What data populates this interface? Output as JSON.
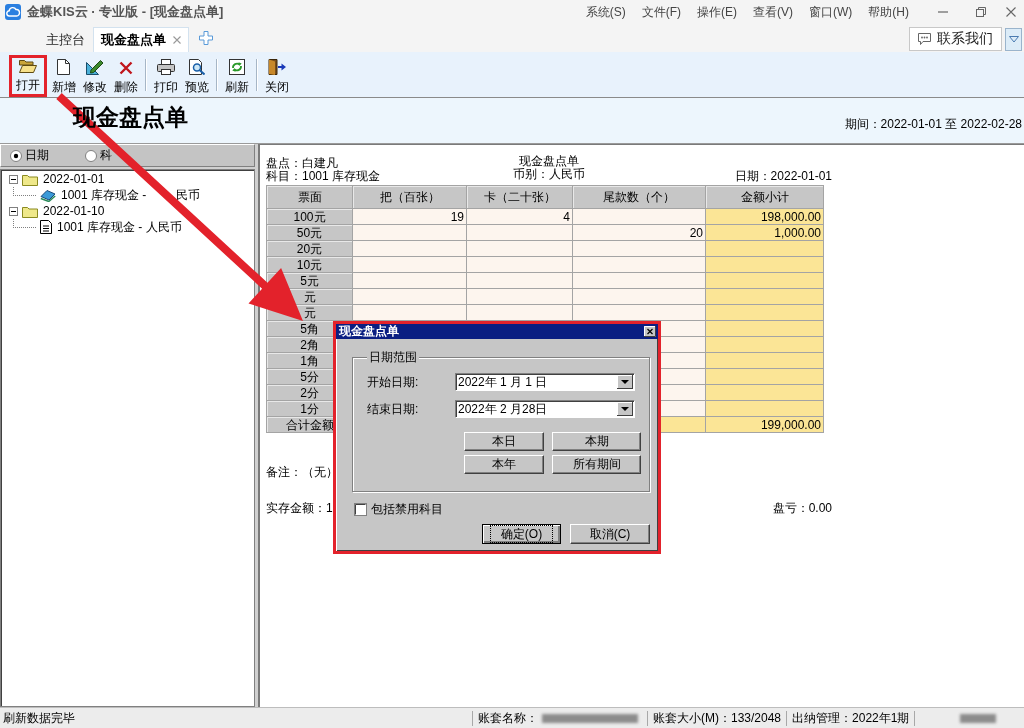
{
  "window": {
    "title": "金蝶KIS云 · 专业版 - [现金盘点单]",
    "menu": [
      "系统(S)",
      "文件(F)",
      "操作(E)",
      "查看(V)",
      "窗口(W)",
      "帮助(H)"
    ]
  },
  "tabs": [
    {
      "label": "主控台",
      "selected": false,
      "closable": false
    },
    {
      "label": "现金盘点单",
      "selected": true,
      "closable": true
    }
  ],
  "contact_button": {
    "label": "联系我们"
  },
  "toolbar": {
    "groups": [
      {
        "items": [
          {
            "label": "打开",
            "highlighted": true
          },
          {
            "label": "新增",
            "highlighted": false
          },
          {
            "label": "修改",
            "highlighted": false
          },
          {
            "label": "删除",
            "highlighted": false
          }
        ]
      },
      {
        "items": [
          {
            "label": "打印",
            "highlighted": false
          },
          {
            "label": "预览",
            "highlighted": false
          }
        ]
      },
      {
        "items": [
          {
            "label": "刷新",
            "highlighted": false
          }
        ]
      },
      {
        "items": [
          {
            "label": "关闭",
            "highlighted": false
          }
        ]
      }
    ]
  },
  "header": {
    "title": "现金盘点单",
    "period": "期间：2022-01-01 至 2022-02-28"
  },
  "filter": {
    "options": [
      {
        "label": "日期",
        "selected": true
      },
      {
        "label": "科",
        "selected": false
      }
    ]
  },
  "tree": [
    {
      "label": "2022-01-01",
      "expanded": true,
      "children": [
        {
          "label": "1001 库存现金 -",
          "label_after_gap": "民币",
          "kind": "cash"
        }
      ]
    },
    {
      "label": "2022-01-10",
      "expanded": true,
      "children": [
        {
          "label": "1001 库存现金 - 人民币",
          "kind": "document"
        }
      ]
    }
  ],
  "sheet": {
    "counter": "盘点：白建凡",
    "account": "科目：1001 库存现金",
    "title": "现金盘点单",
    "currency": "币别：人民币",
    "date": "日期：2022-01-01",
    "table": {
      "columns": [
        "票面",
        "把（百张）",
        "卡（二十张）",
        "尾款数（个）",
        "金额小计"
      ],
      "rows": [
        {
          "kind": "note",
          "label": "100元",
          "bundle": "19",
          "card": "4",
          "subtotal": "198,000.00"
        },
        {
          "kind": "note",
          "label": "50元",
          "loose": "20",
          "subtotal": "1,000.00"
        },
        {
          "kind": "note",
          "label": "20元"
        },
        {
          "kind": "note",
          "label": "10元"
        },
        {
          "kind": "note",
          "label": "5元"
        },
        {
          "kind": "note",
          "label": "元"
        },
        {
          "kind": "note",
          "label": "元"
        },
        {
          "kind": "note",
          "label": "5角"
        },
        {
          "kind": "note",
          "label": "2角"
        },
        {
          "kind": "note",
          "label": "1角"
        },
        {
          "kind": "note",
          "label": "5分"
        },
        {
          "kind": "note",
          "label": "2分"
        },
        {
          "kind": "note",
          "label": "1分"
        },
        {
          "kind": "total",
          "label": "合计金额",
          "subtotal": "199,000.00"
        }
      ]
    },
    "remark": "备注：（无）",
    "actual_amount": "实存金额：1",
    "shortage": "盘亏：0.00"
  },
  "dialog": {
    "title": "现金盘点单",
    "highlighted": true,
    "group_label": "日期范围",
    "fields": [
      {
        "label": "开始日期:",
        "value": "2022年 1 月 1 日"
      },
      {
        "label": "结束日期:",
        "value": "2022年 2 月28日"
      }
    ],
    "range_buttons": [
      "本日",
      "本期",
      "本年",
      "所有期间"
    ],
    "checkbox": {
      "label": "包括禁用科目",
      "checked": false
    },
    "buttons": [
      {
        "label": "确定(O)",
        "default": true
      },
      {
        "label": "取消(C)",
        "default": false
      }
    ]
  },
  "status_bar": {
    "message": "刷新数据完毕",
    "account_name_label": "账套名称：",
    "account_size": "账套大小(M)：133/2048",
    "cashier": "出纳管理：2022年1期"
  }
}
